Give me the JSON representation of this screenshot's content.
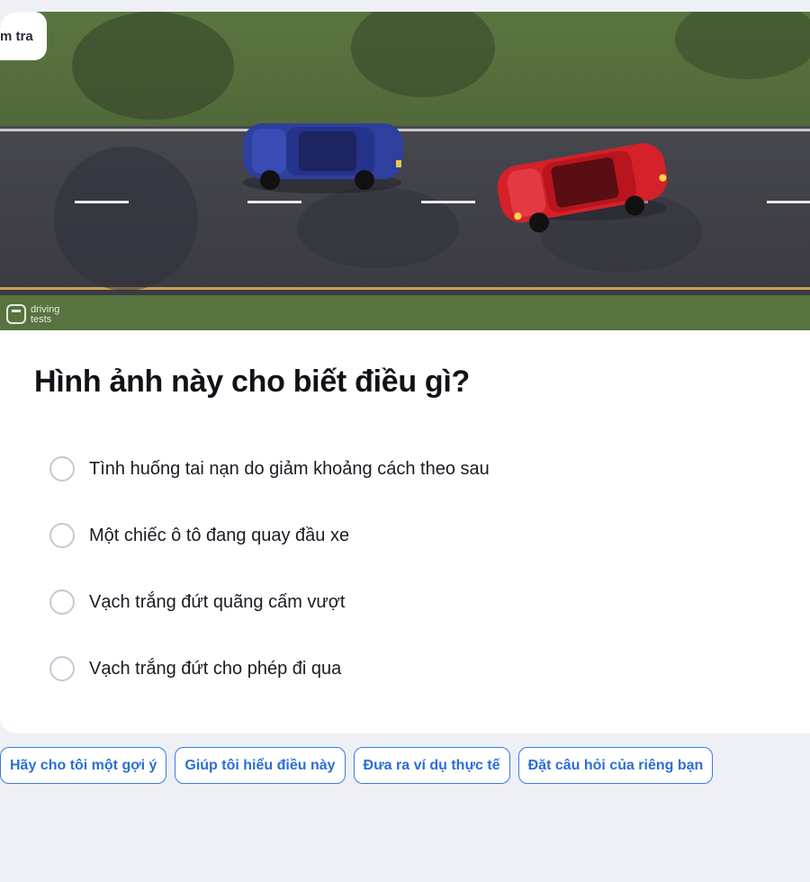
{
  "header": {
    "check_label": "m tra"
  },
  "scene": {
    "watermark_line1": "driving",
    "watermark_line2": "tests",
    "colors": {
      "grass": "#4f6a36",
      "road": "#3e3f45",
      "blue_car": "#2f3f9e",
      "red_car": "#d4212a"
    }
  },
  "question": {
    "title": "Hình ảnh này cho biết điều gì?",
    "options": [
      {
        "label": "Tình huống tai nạn do giảm khoảng cách theo sau"
      },
      {
        "label": "Một chiếc ô tô đang quay đầu xe"
      },
      {
        "label": "Vạch trắng đứt quãng cấm vượt"
      },
      {
        "label": "Vạch trắng đứt cho phép đi qua"
      }
    ]
  },
  "actions": [
    {
      "label": "Hãy cho tôi một gợi ý"
    },
    {
      "label": "Giúp tôi hiểu điều này"
    },
    {
      "label": "Đưa ra ví dụ thực tế"
    },
    {
      "label": "Đặt câu hỏi của riêng bạn"
    }
  ],
  "accent_color": "#2a6fd6"
}
